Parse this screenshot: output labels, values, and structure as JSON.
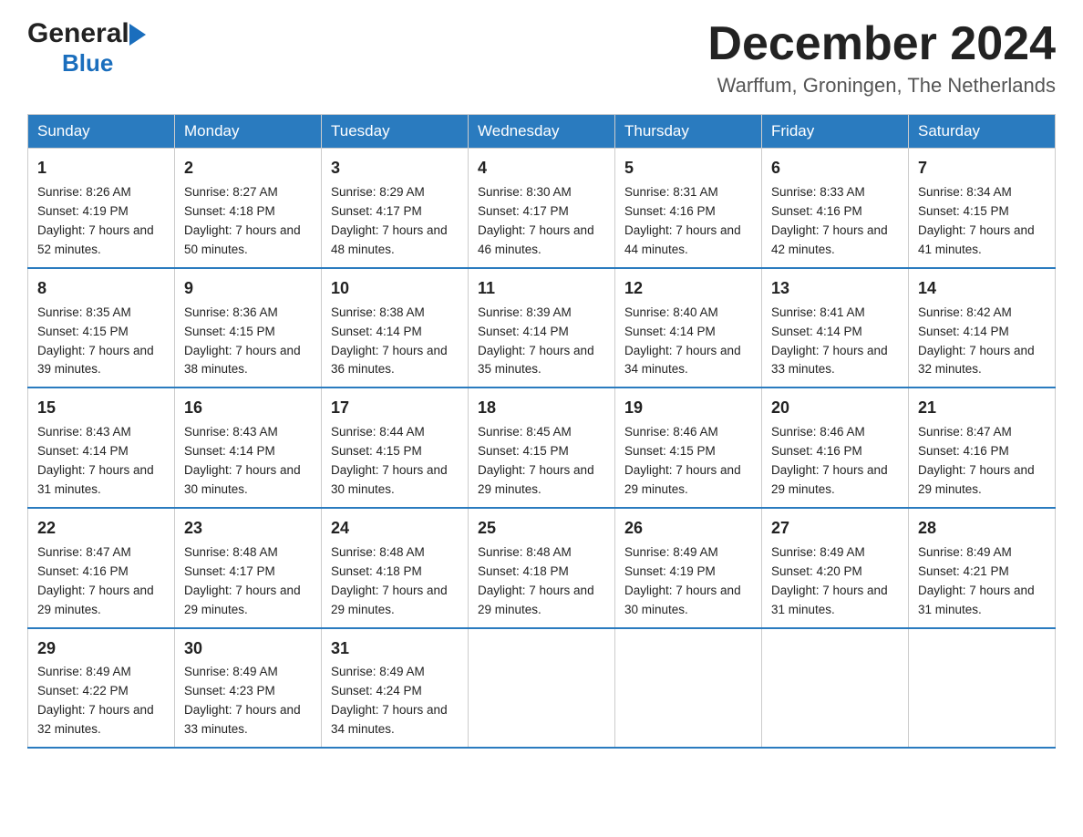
{
  "header": {
    "logo_general": "General",
    "logo_blue": "Blue",
    "month_title": "December 2024",
    "location": "Warffum, Groningen, The Netherlands"
  },
  "days_of_week": [
    "Sunday",
    "Monday",
    "Tuesday",
    "Wednesday",
    "Thursday",
    "Friday",
    "Saturday"
  ],
  "weeks": [
    [
      {
        "day": "1",
        "sunrise": "8:26 AM",
        "sunset": "4:19 PM",
        "daylight": "7 hours and 52 minutes."
      },
      {
        "day": "2",
        "sunrise": "8:27 AM",
        "sunset": "4:18 PM",
        "daylight": "7 hours and 50 minutes."
      },
      {
        "day": "3",
        "sunrise": "8:29 AM",
        "sunset": "4:17 PM",
        "daylight": "7 hours and 48 minutes."
      },
      {
        "day": "4",
        "sunrise": "8:30 AM",
        "sunset": "4:17 PM",
        "daylight": "7 hours and 46 minutes."
      },
      {
        "day": "5",
        "sunrise": "8:31 AM",
        "sunset": "4:16 PM",
        "daylight": "7 hours and 44 minutes."
      },
      {
        "day": "6",
        "sunrise": "8:33 AM",
        "sunset": "4:16 PM",
        "daylight": "7 hours and 42 minutes."
      },
      {
        "day": "7",
        "sunrise": "8:34 AM",
        "sunset": "4:15 PM",
        "daylight": "7 hours and 41 minutes."
      }
    ],
    [
      {
        "day": "8",
        "sunrise": "8:35 AM",
        "sunset": "4:15 PM",
        "daylight": "7 hours and 39 minutes."
      },
      {
        "day": "9",
        "sunrise": "8:36 AM",
        "sunset": "4:15 PM",
        "daylight": "7 hours and 38 minutes."
      },
      {
        "day": "10",
        "sunrise": "8:38 AM",
        "sunset": "4:14 PM",
        "daylight": "7 hours and 36 minutes."
      },
      {
        "day": "11",
        "sunrise": "8:39 AM",
        "sunset": "4:14 PM",
        "daylight": "7 hours and 35 minutes."
      },
      {
        "day": "12",
        "sunrise": "8:40 AM",
        "sunset": "4:14 PM",
        "daylight": "7 hours and 34 minutes."
      },
      {
        "day": "13",
        "sunrise": "8:41 AM",
        "sunset": "4:14 PM",
        "daylight": "7 hours and 33 minutes."
      },
      {
        "day": "14",
        "sunrise": "8:42 AM",
        "sunset": "4:14 PM",
        "daylight": "7 hours and 32 minutes."
      }
    ],
    [
      {
        "day": "15",
        "sunrise": "8:43 AM",
        "sunset": "4:14 PM",
        "daylight": "7 hours and 31 minutes."
      },
      {
        "day": "16",
        "sunrise": "8:43 AM",
        "sunset": "4:14 PM",
        "daylight": "7 hours and 30 minutes."
      },
      {
        "day": "17",
        "sunrise": "8:44 AM",
        "sunset": "4:15 PM",
        "daylight": "7 hours and 30 minutes."
      },
      {
        "day": "18",
        "sunrise": "8:45 AM",
        "sunset": "4:15 PM",
        "daylight": "7 hours and 29 minutes."
      },
      {
        "day": "19",
        "sunrise": "8:46 AM",
        "sunset": "4:15 PM",
        "daylight": "7 hours and 29 minutes."
      },
      {
        "day": "20",
        "sunrise": "8:46 AM",
        "sunset": "4:16 PM",
        "daylight": "7 hours and 29 minutes."
      },
      {
        "day": "21",
        "sunrise": "8:47 AM",
        "sunset": "4:16 PM",
        "daylight": "7 hours and 29 minutes."
      }
    ],
    [
      {
        "day": "22",
        "sunrise": "8:47 AM",
        "sunset": "4:16 PM",
        "daylight": "7 hours and 29 minutes."
      },
      {
        "day": "23",
        "sunrise": "8:48 AM",
        "sunset": "4:17 PM",
        "daylight": "7 hours and 29 minutes."
      },
      {
        "day": "24",
        "sunrise": "8:48 AM",
        "sunset": "4:18 PM",
        "daylight": "7 hours and 29 minutes."
      },
      {
        "day": "25",
        "sunrise": "8:48 AM",
        "sunset": "4:18 PM",
        "daylight": "7 hours and 29 minutes."
      },
      {
        "day": "26",
        "sunrise": "8:49 AM",
        "sunset": "4:19 PM",
        "daylight": "7 hours and 30 minutes."
      },
      {
        "day": "27",
        "sunrise": "8:49 AM",
        "sunset": "4:20 PM",
        "daylight": "7 hours and 31 minutes."
      },
      {
        "day": "28",
        "sunrise": "8:49 AM",
        "sunset": "4:21 PM",
        "daylight": "7 hours and 31 minutes."
      }
    ],
    [
      {
        "day": "29",
        "sunrise": "8:49 AM",
        "sunset": "4:22 PM",
        "daylight": "7 hours and 32 minutes."
      },
      {
        "day": "30",
        "sunrise": "8:49 AM",
        "sunset": "4:23 PM",
        "daylight": "7 hours and 33 minutes."
      },
      {
        "day": "31",
        "sunrise": "8:49 AM",
        "sunset": "4:24 PM",
        "daylight": "7 hours and 34 minutes."
      },
      null,
      null,
      null,
      null
    ]
  ],
  "labels": {
    "sunrise": "Sunrise:",
    "sunset": "Sunset:",
    "daylight": "Daylight:"
  }
}
